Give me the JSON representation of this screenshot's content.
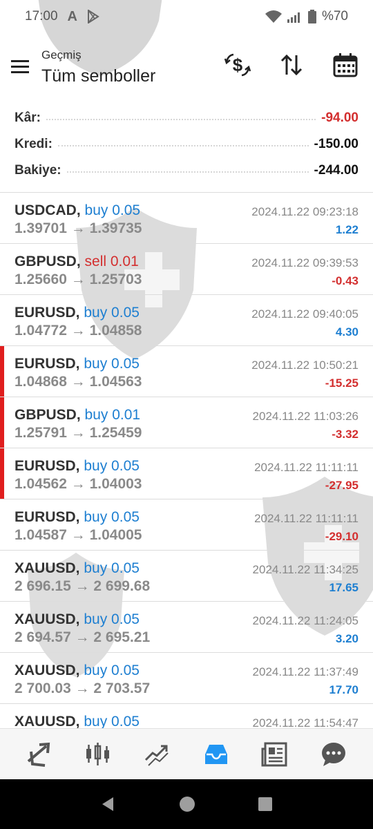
{
  "status_bar": {
    "time": "17:00",
    "battery_text": "%70",
    "icons": [
      "a-logo-icon",
      "play-store-icon",
      "wifi-icon",
      "signal-icon",
      "battery-icon"
    ]
  },
  "header": {
    "subtitle": "Geçmiş",
    "title": "Tüm semboller",
    "actions": [
      "currency-exchange-icon",
      "sort-icon",
      "calendar-icon"
    ]
  },
  "summary": {
    "profit": {
      "label": "Kâr:",
      "value": "-94.00"
    },
    "credit": {
      "label": "Kredi:",
      "value": "-150.00"
    },
    "balance": {
      "label": "Bakiye:",
      "value": "-244.00"
    }
  },
  "trades": [
    {
      "symbol": "USDCAD,",
      "side": "buy 0.05",
      "side_type": "buy",
      "prices": "1.39701 → 1.39735",
      "time": "2024.11.22 09:23:18",
      "profit": "1.22",
      "marked": false
    },
    {
      "symbol": "GBPUSD,",
      "side": "sell 0.01",
      "side_type": "sell",
      "prices": "1.25660 → 1.25703",
      "time": "2024.11.22 09:39:53",
      "profit": "-0.43",
      "marked": false
    },
    {
      "symbol": "EURUSD,",
      "side": "buy 0.05",
      "side_type": "buy",
      "prices": "1.04772 → 1.04858",
      "time": "2024.11.22 09:40:05",
      "profit": "4.30",
      "marked": false
    },
    {
      "symbol": "EURUSD,",
      "side": "buy 0.05",
      "side_type": "buy",
      "prices": "1.04868 → 1.04563",
      "time": "2024.11.22 10:50:21",
      "profit": "-15.25",
      "marked": true
    },
    {
      "symbol": "GBPUSD,",
      "side": "buy 0.01",
      "side_type": "buy",
      "prices": "1.25791 → 1.25459",
      "time": "2024.11.22 11:03:26",
      "profit": "-3.32",
      "marked": true
    },
    {
      "symbol": "EURUSD,",
      "side": "buy 0.05",
      "side_type": "buy",
      "prices": "1.04562 → 1.04003",
      "time": "2024.11.22 11:11:11",
      "profit": "-27.95",
      "marked": true
    },
    {
      "symbol": "EURUSD,",
      "side": "buy 0.05",
      "side_type": "buy",
      "prices": "1.04587 → 1.04005",
      "time": "2024.11.22 11:11:11",
      "profit": "-29.10",
      "marked": false
    },
    {
      "symbol": "XAUUSD,",
      "side": "buy 0.05",
      "side_type": "buy",
      "prices": "2 696.15 → 2 699.68",
      "time": "2024.11.22 11:34:25",
      "profit": "17.65",
      "marked": false
    },
    {
      "symbol": "XAUUSD,",
      "side": "buy 0.05",
      "side_type": "buy",
      "prices": "2 694.57 → 2 695.21",
      "time": "2024.11.22 11:24:05",
      "profit": "3.20",
      "marked": false
    },
    {
      "symbol": "XAUUSD,",
      "side": "buy 0.05",
      "side_type": "buy",
      "prices": "2 700.03 → 2 703.57",
      "time": "2024.11.22 11:37:49",
      "profit": "17.70",
      "marked": false
    },
    {
      "symbol": "XAUUSD,",
      "side": "buy 0.05",
      "side_type": "buy",
      "prices": "",
      "time": "2024.11.22 11:54:47",
      "profit": "",
      "marked": false
    }
  ],
  "bottom_nav": [
    "quotes-icon",
    "chart-icon",
    "trade-icon",
    "history-icon",
    "news-icon",
    "chat-icon"
  ],
  "system_nav": [
    "back-icon",
    "home-icon",
    "recents-icon"
  ],
  "colors": {
    "buy": "#1e7fd1",
    "sell": "#d32f2f",
    "profit_positive": "#1e7fd1",
    "profit_negative": "#d32f2f",
    "marker": "#e01e1e",
    "active_nav": "#2196f3"
  }
}
